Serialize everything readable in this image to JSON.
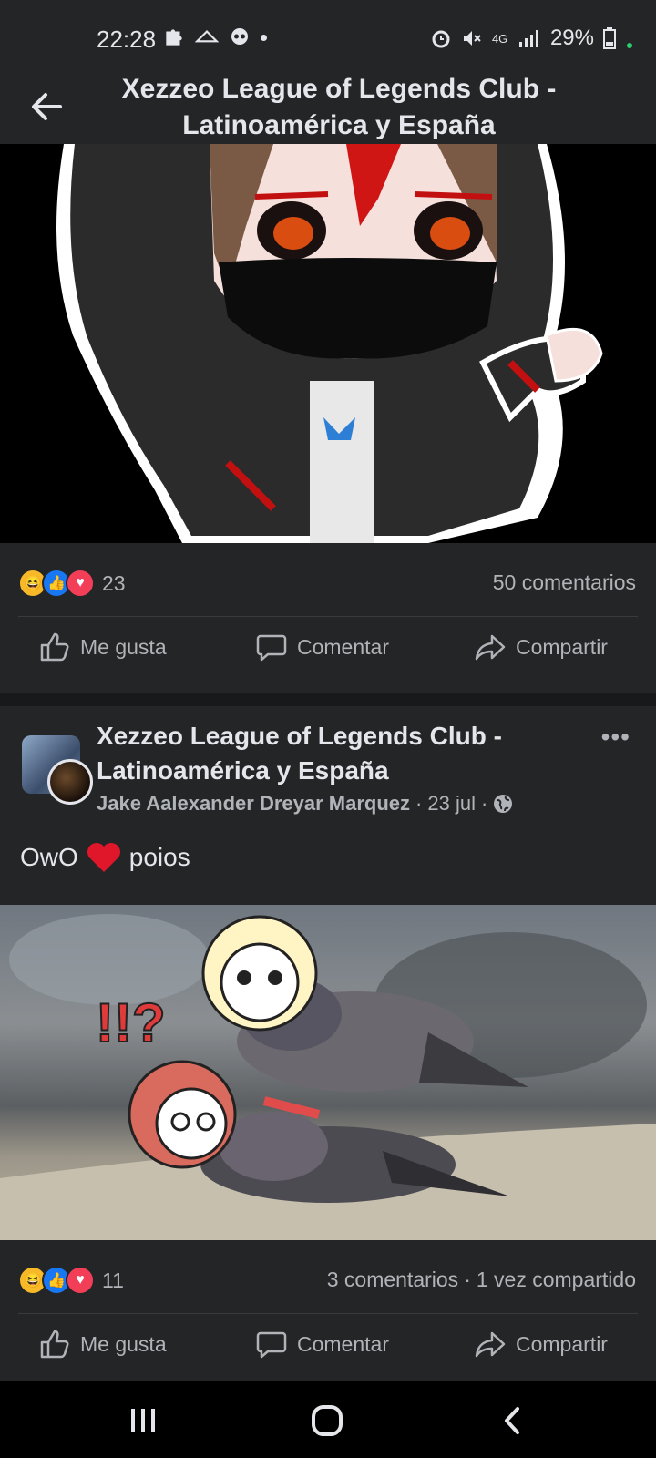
{
  "status_bar": {
    "time": "22:28",
    "battery": "29%",
    "network": "4G"
  },
  "header": {
    "title": "Xezzeo League of Legends Club - Latinoamérica y España"
  },
  "post1": {
    "reaction_count": "23",
    "comments": "50 comentarios",
    "actions": {
      "like": "Me gusta",
      "comment": "Comentar",
      "share": "Compartir"
    }
  },
  "post2": {
    "group_name": "Xezzeo League of Legends Club - Latinoamérica y España",
    "author": "Jake Aalexander Dreyar Marquez",
    "date": "23 jul",
    "text_before": "OwO",
    "text_after": "poios",
    "reaction_count": "11",
    "comments": "3 comentarios",
    "shares": "1 vez compartido",
    "actions": {
      "like": "Me gusta",
      "comment": "Comentar",
      "share": "Compartir"
    }
  },
  "colors": {
    "background": "#18191a",
    "card": "#242526",
    "text_primary": "#e4e6eb",
    "text_secondary": "#b0b3b8",
    "like_blue": "#1877f2",
    "love_red": "#f33e58",
    "haha_yellow": "#f7b928"
  },
  "icons": [
    "back-arrow-icon",
    "like-icon",
    "comment-icon",
    "share-icon",
    "globe-icon",
    "more-icon",
    "recents-icon",
    "home-icon",
    "nav-back-icon"
  ]
}
